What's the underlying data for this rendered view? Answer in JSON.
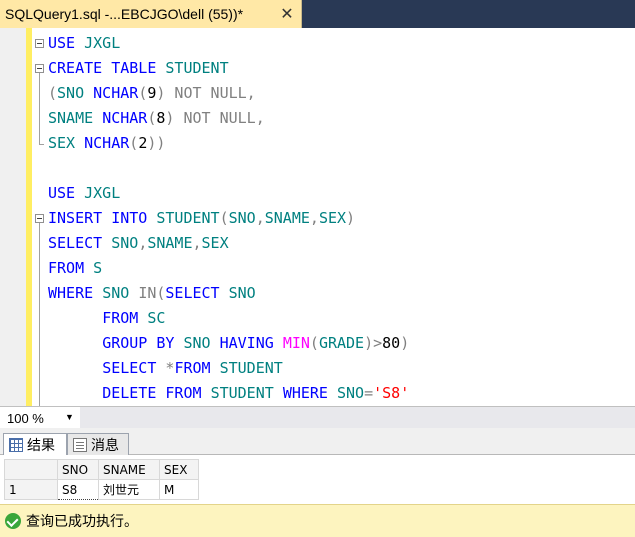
{
  "tab": {
    "title": "SQLQuery1.sql -...EBCJGO\\dell (55))*",
    "close_glyph": "✕"
  },
  "code_lines": [
    [
      {
        "c": "kw",
        "t": "USE "
      },
      {
        "c": "id",
        "t": "JXGL"
      }
    ],
    [
      {
        "c": "kw",
        "t": "CREATE TABLE "
      },
      {
        "c": "id",
        "t": "STUDENT"
      }
    ],
    [
      {
        "c": "gr",
        "t": "("
      },
      {
        "c": "id",
        "t": "SNO "
      },
      {
        "c": "kw",
        "t": "NCHAR"
      },
      {
        "c": "gr",
        "t": "("
      },
      {
        "c": "tx",
        "t": "9"
      },
      {
        "c": "gr",
        "t": ") NOT NULL,"
      }
    ],
    [
      {
        "c": "id",
        "t": "SNAME "
      },
      {
        "c": "kw",
        "t": "NCHAR"
      },
      {
        "c": "gr",
        "t": "("
      },
      {
        "c": "tx",
        "t": "8"
      },
      {
        "c": "gr",
        "t": ") NOT NULL,"
      }
    ],
    [
      {
        "c": "id",
        "t": "SEX "
      },
      {
        "c": "kw",
        "t": "NCHAR"
      },
      {
        "c": "gr",
        "t": "("
      },
      {
        "c": "tx",
        "t": "2"
      },
      {
        "c": "gr",
        "t": "))"
      }
    ],
    [],
    [
      {
        "c": "kw",
        "t": "USE "
      },
      {
        "c": "id",
        "t": "JXGL"
      }
    ],
    [
      {
        "c": "kw",
        "t": "INSERT INTO "
      },
      {
        "c": "id",
        "t": "STUDENT"
      },
      {
        "c": "gr",
        "t": "("
      },
      {
        "c": "id",
        "t": "SNO"
      },
      {
        "c": "gr",
        "t": ","
      },
      {
        "c": "id",
        "t": "SNAME"
      },
      {
        "c": "gr",
        "t": ","
      },
      {
        "c": "id",
        "t": "SEX"
      },
      {
        "c": "gr",
        "t": ")"
      }
    ],
    [
      {
        "c": "kw",
        "t": "SELECT "
      },
      {
        "c": "id",
        "t": "SNO"
      },
      {
        "c": "gr",
        "t": ","
      },
      {
        "c": "id",
        "t": "SNAME"
      },
      {
        "c": "gr",
        "t": ","
      },
      {
        "c": "id",
        "t": "SEX"
      }
    ],
    [
      {
        "c": "kw",
        "t": "FROM "
      },
      {
        "c": "id",
        "t": "S"
      }
    ],
    [
      {
        "c": "kw",
        "t": "WHERE "
      },
      {
        "c": "id",
        "t": "SNO "
      },
      {
        "c": "gr",
        "t": "IN("
      },
      {
        "c": "kw",
        "t": "SELECT "
      },
      {
        "c": "id",
        "t": "SNO"
      }
    ],
    [
      {
        "c": "tx",
        "t": "      "
      },
      {
        "c": "kw",
        "t": "FROM "
      },
      {
        "c": "id",
        "t": "SC"
      }
    ],
    [
      {
        "c": "tx",
        "t": "      "
      },
      {
        "c": "kw",
        "t": "GROUP BY "
      },
      {
        "c": "id",
        "t": "SNO "
      },
      {
        "c": "kw",
        "t": "HAVING "
      },
      {
        "c": "fn",
        "t": "MIN"
      },
      {
        "c": "gr",
        "t": "("
      },
      {
        "c": "id",
        "t": "GRADE"
      },
      {
        "c": "gr",
        "t": ")>"
      },
      {
        "c": "tx",
        "t": "80"
      },
      {
        "c": "gr",
        "t": ")"
      }
    ],
    [
      {
        "c": "tx",
        "t": "      "
      },
      {
        "c": "kw",
        "t": "SELECT "
      },
      {
        "c": "gr",
        "t": "*"
      },
      {
        "c": "kw",
        "t": "FROM "
      },
      {
        "c": "id",
        "t": "STUDENT"
      }
    ],
    [
      {
        "c": "tx",
        "t": "      "
      },
      {
        "c": "kw",
        "t": "DELETE FROM "
      },
      {
        "c": "id",
        "t": "STUDENT "
      },
      {
        "c": "kw",
        "t": "WHERE "
      },
      {
        "c": "id",
        "t": "SNO"
      },
      {
        "c": "gr",
        "t": "="
      },
      {
        "c": "st",
        "t": "'S8'"
      }
    ]
  ],
  "zoom": {
    "value": "100 %"
  },
  "result_tabs": {
    "results": "结果",
    "messages": "消息"
  },
  "grid": {
    "columns": [
      "SNO",
      "SNAME",
      "SEX"
    ],
    "rows": [
      {
        "num": "1",
        "cells": [
          "S8",
          "刘世元",
          "M"
        ]
      }
    ]
  },
  "status": {
    "text": "查询已成功执行。"
  },
  "colors": {
    "tab_active": "#ffe8a6",
    "status_bg": "#fdf4bf",
    "keyword": "#0000ff",
    "identifier": "#008080",
    "string": "#ff0000",
    "function": "#ff00ff",
    "operator": "#808080"
  }
}
